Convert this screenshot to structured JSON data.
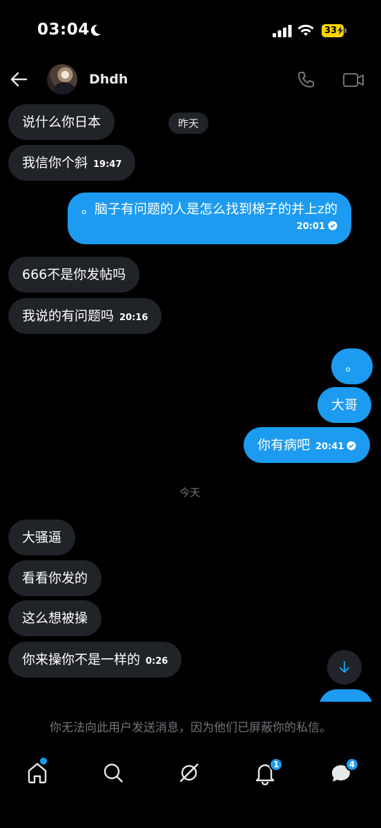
{
  "status_bar": {
    "time": "03:04",
    "battery": "33"
  },
  "header": {
    "contact_name": "Dhdh"
  },
  "messages": [
    {
      "dir": "in",
      "text": "说什么你日本",
      "time": ""
    },
    {
      "dir": "in",
      "text": "我信你个斜",
      "time": "19:47"
    },
    {
      "dir": "out",
      "text": "。脑子有问题的人是怎么找到梯子的并上z的",
      "time": "20:01"
    },
    {
      "dir": "in",
      "text": "666不是你发帖吗",
      "time": ""
    },
    {
      "dir": "in",
      "text": "我说的有问题吗",
      "time": "20:16"
    },
    {
      "dir": "out",
      "text": "。",
      "time": ""
    },
    {
      "dir": "out",
      "text": "大哥",
      "time": ""
    },
    {
      "dir": "out",
      "text": "你有病吧",
      "time": "20:41"
    },
    {
      "dir": "in",
      "text": "大骚逼",
      "time": ""
    },
    {
      "dir": "in",
      "text": "看看你发的",
      "time": ""
    },
    {
      "dir": "in",
      "text": "这么想被操",
      "time": ""
    },
    {
      "dir": "in",
      "text": "你来操你不是一样的",
      "time": "0:26"
    }
  ],
  "day_separators": {
    "yesterday": "昨天",
    "today": "今天"
  },
  "notice": "你无法向此用户发送消息，因为他们已屏蔽你的私信。",
  "nav": {
    "notifications_badge": "1",
    "messages_badge": "4"
  },
  "colors": {
    "accent": "#1d9bf0",
    "incoming_bubble": "#202327",
    "background": "#000000",
    "muted_text": "#71767b"
  }
}
